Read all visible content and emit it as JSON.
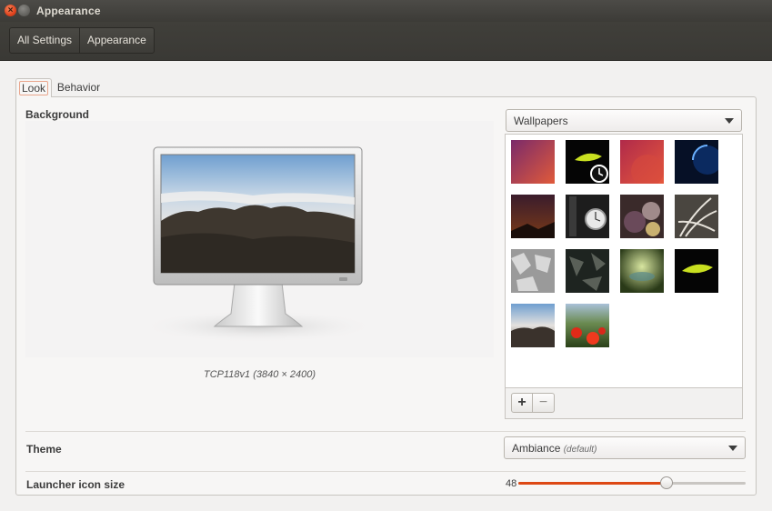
{
  "window": {
    "title": "Appearance"
  },
  "toolbar": {
    "crumbs": [
      "All Settings",
      "Appearance"
    ]
  },
  "tabs": [
    {
      "label": "Look",
      "active": true
    },
    {
      "label": "Behavior",
      "active": false
    }
  ],
  "background": {
    "label": "Background",
    "caption": "TCP118v1 (3840 × 2400)",
    "source_dropdown": "Wallpapers",
    "wallpapers": [
      {
        "name": "purple-gradient-wallpaper",
        "selected": false
      },
      {
        "name": "clock-flower-wallpaper",
        "selected": true
      },
      {
        "name": "red-circle-wallpaper",
        "selected": false
      },
      {
        "name": "blue-planet-wallpaper",
        "selected": false
      },
      {
        "name": "night-sky-wallpaper",
        "selected": false
      },
      {
        "name": "pocket-watch-wallpaper",
        "selected": false
      },
      {
        "name": "marbles-wallpaper",
        "selected": false
      },
      {
        "name": "grass-wallpaper",
        "selected": false
      },
      {
        "name": "ice-wallpaper",
        "selected": false
      },
      {
        "name": "dark-texture-wallpaper",
        "selected": false
      },
      {
        "name": "water-drop-wallpaper",
        "selected": false
      },
      {
        "name": "green-flower-wallpaper",
        "selected": false
      },
      {
        "name": "foggy-forest-wallpaper",
        "selected": false
      },
      {
        "name": "red-flowers-wallpaper",
        "selected": false
      }
    ],
    "add_label": "+",
    "remove_label": "−"
  },
  "theme": {
    "label": "Theme",
    "value": "Ambiance",
    "note": "(default)"
  },
  "launcher": {
    "label": "Launcher icon size",
    "value": "48",
    "min": 16,
    "max": 64
  },
  "colors": {
    "accent": "#dd4814",
    "titlebar": "#3c3b37",
    "window_bg": "#f2f1f0"
  },
  "icons": {
    "close": "close-icon",
    "minimize": "minimize-icon",
    "dropdown": "chevron-down-icon"
  }
}
